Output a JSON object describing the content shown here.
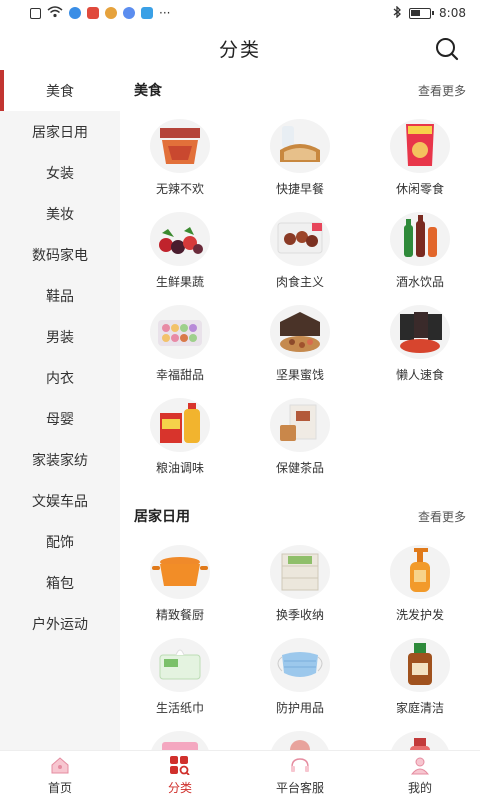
{
  "status": {
    "time": "8:08",
    "more": "···"
  },
  "header": {
    "title": "分类"
  },
  "sidebar": {
    "items": [
      {
        "label": "美食"
      },
      {
        "label": "居家日用"
      },
      {
        "label": "女装"
      },
      {
        "label": "美妆"
      },
      {
        "label": "数码家电"
      },
      {
        "label": "鞋品"
      },
      {
        "label": "男装"
      },
      {
        "label": "内衣"
      },
      {
        "label": "母婴"
      },
      {
        "label": "家装家纺"
      },
      {
        "label": "文娱车品"
      },
      {
        "label": "配饰"
      },
      {
        "label": "箱包"
      },
      {
        "label": "户外运动"
      }
    ]
  },
  "sections": [
    {
      "title": "美食",
      "more": "查看更多",
      "items": [
        {
          "label": "无辣不欢",
          "icon": "spicy-snack-icon"
        },
        {
          "label": "快捷早餐",
          "icon": "bread-icon"
        },
        {
          "label": "休闲零食",
          "icon": "chips-icon"
        },
        {
          "label": "生鲜果蔬",
          "icon": "fruit-icon"
        },
        {
          "label": "肉食主义",
          "icon": "meat-icon"
        },
        {
          "label": "酒水饮品",
          "icon": "drinks-icon"
        },
        {
          "label": "幸福甜品",
          "icon": "dessert-icon"
        },
        {
          "label": "坚果蜜饯",
          "icon": "nuts-icon"
        },
        {
          "label": "懒人速食",
          "icon": "noodle-icon"
        },
        {
          "label": "粮油调味",
          "icon": "oil-icon"
        },
        {
          "label": "保健茶品",
          "icon": "tea-icon"
        }
      ]
    },
    {
      "title": "居家日用",
      "more": "查看更多",
      "items": [
        {
          "label": "精致餐厨",
          "icon": "pot-icon"
        },
        {
          "label": "换季收纳",
          "icon": "storage-icon"
        },
        {
          "label": "洗发护发",
          "icon": "shampoo-icon"
        },
        {
          "label": "生活纸巾",
          "icon": "tissue-icon"
        },
        {
          "label": "防护用品",
          "icon": "mask-icon"
        },
        {
          "label": "家庭清洁",
          "icon": "cleaner-icon"
        },
        {
          "label": "",
          "icon": "pink-box-icon"
        },
        {
          "label": "",
          "icon": "toy-icon"
        },
        {
          "label": "",
          "icon": "bottle-icon"
        }
      ]
    }
  ],
  "bottom_nav": [
    {
      "label": "首页",
      "icon": "home-icon"
    },
    {
      "label": "分类",
      "icon": "category-icon"
    },
    {
      "label": "平台客服",
      "icon": "service-icon"
    },
    {
      "label": "我的",
      "icon": "profile-icon"
    }
  ],
  "colors": {
    "accent": "#d0302c",
    "sidebar_bg": "#f5f5f5",
    "active_bar": "#c23531"
  }
}
